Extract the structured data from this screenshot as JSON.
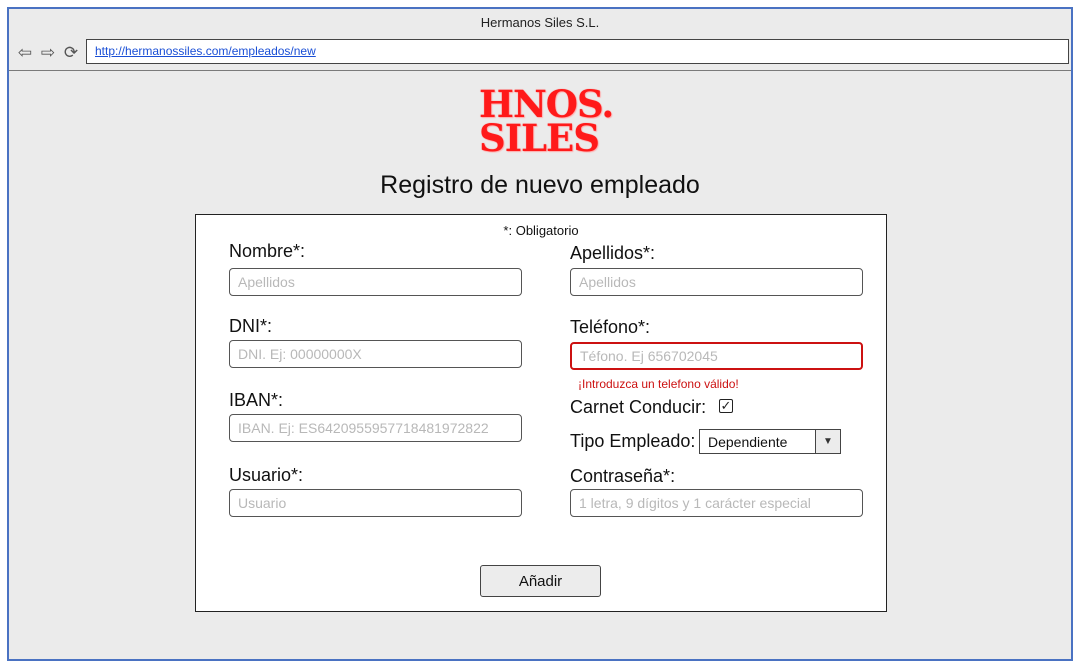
{
  "window": {
    "title": "Hermanos Siles S.L."
  },
  "browser": {
    "url": "http://hermanossiles.com/empleados/new"
  },
  "logo": {
    "line1": "HNOS.",
    "line2": "SILES"
  },
  "page": {
    "title": "Registro de nuevo empleado"
  },
  "form": {
    "required_note": "*: Obligatorio",
    "nombre": {
      "label": "Nombre*:",
      "placeholder": "Apellidos",
      "value": ""
    },
    "apellidos": {
      "label": "Apellidos*:",
      "placeholder": "Apellidos",
      "value": ""
    },
    "dni": {
      "label": "DNI*:",
      "placeholder": "DNI. Ej: 00000000X",
      "value": ""
    },
    "telefono": {
      "label": "Teléfono*:",
      "placeholder": "Téfono. Ej 656702045",
      "value": "",
      "error": "¡Introduzca un telefono válido!"
    },
    "iban": {
      "label": "IBAN*:",
      "placeholder": "IBAN. Ej: ES6420955957718481972822",
      "value": ""
    },
    "carnet": {
      "label": "Carnet Conducir:",
      "checked": true,
      "check_glyph": "✓"
    },
    "tipo": {
      "label": "Tipo Empleado:",
      "selected": "Dependiente"
    },
    "usuario": {
      "label": "Usuario*:",
      "placeholder": "Usuario",
      "value": ""
    },
    "contrasena": {
      "label": "Contraseña*:",
      "placeholder": "1 letra, 9 dígitos y 1 carácter especial",
      "value": ""
    },
    "submit_label": "Añadir"
  },
  "colors": {
    "accent_border": "#4a72c2",
    "error": "#cc1111",
    "logo": "#ff1a1a"
  }
}
